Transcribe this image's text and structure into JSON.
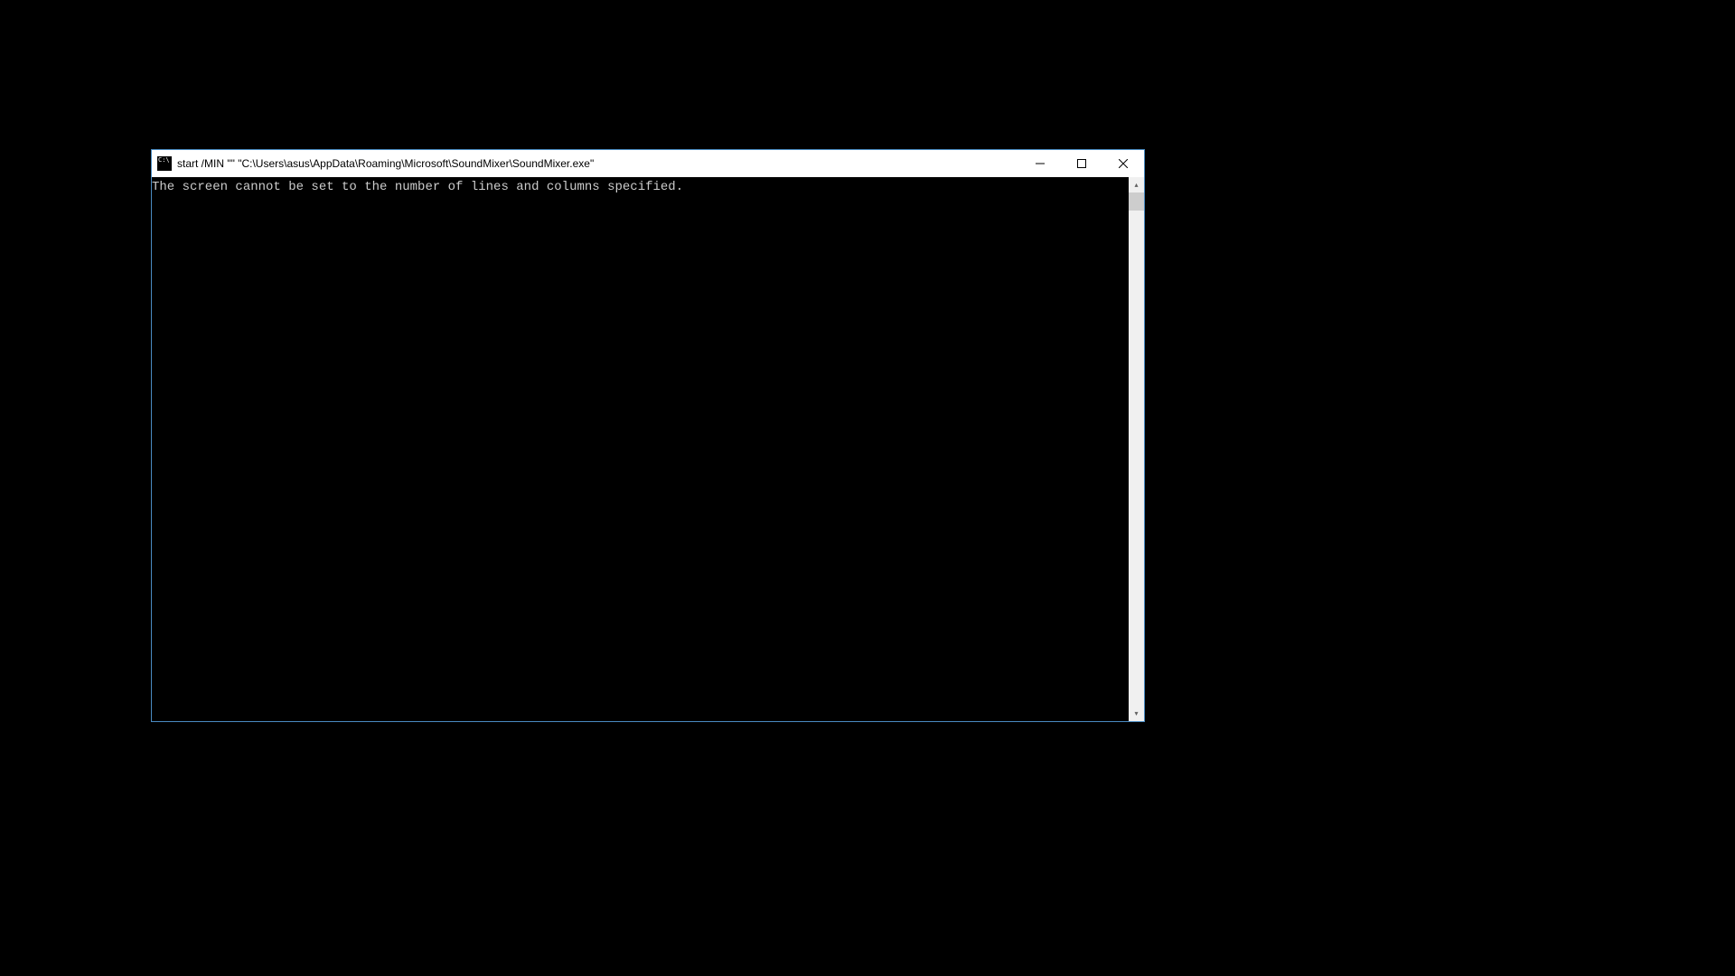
{
  "window": {
    "title": "start  /MIN \"\" \"C:\\Users\\asus\\AppData\\Roaming\\Microsoft\\SoundMixer\\SoundMixer.exe\"",
    "icon": "cmd-icon"
  },
  "console": {
    "output": "The screen cannot be set to the number of lines and columns specified."
  }
}
